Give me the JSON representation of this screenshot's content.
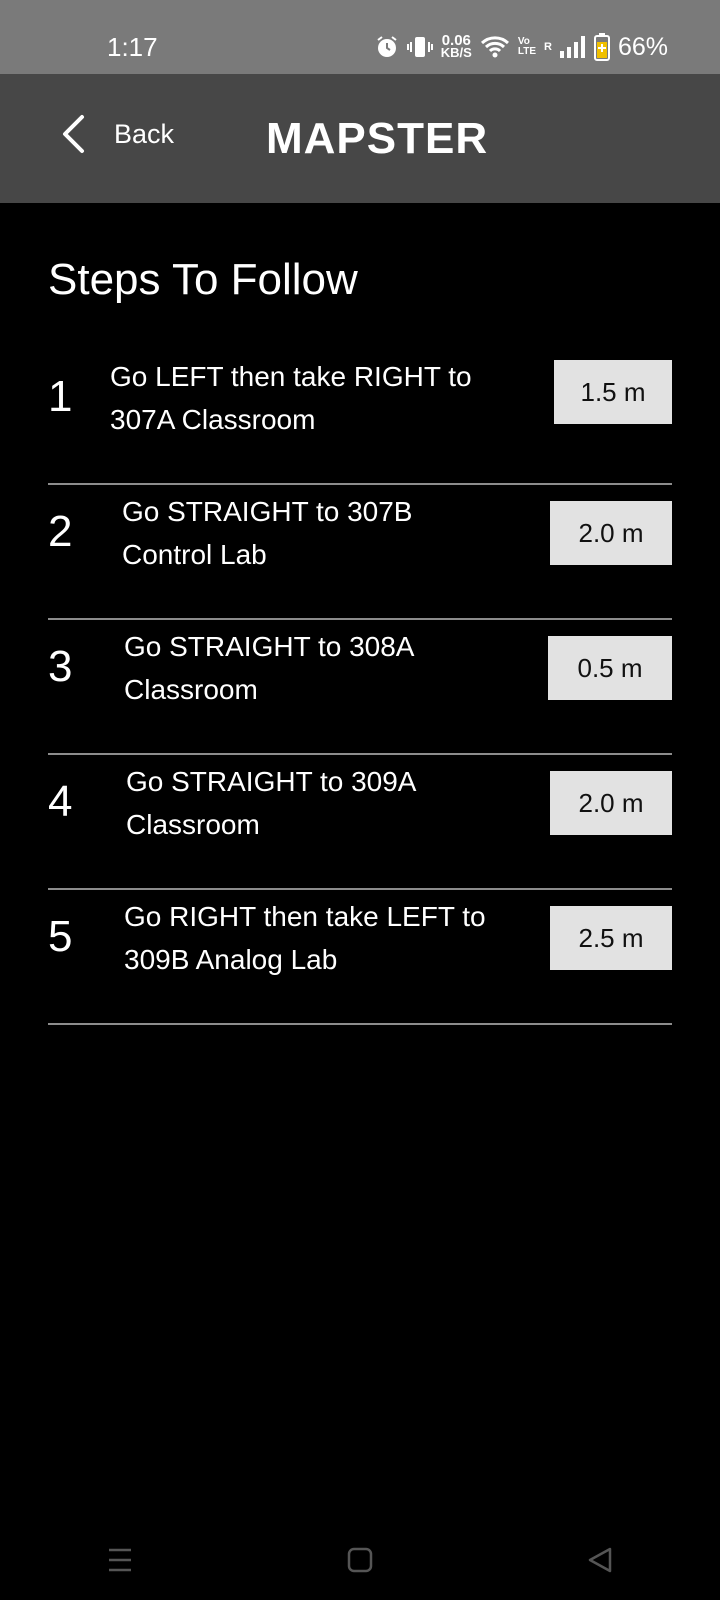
{
  "status_bar": {
    "time": "1:17",
    "net_speed_value": "0.06",
    "net_speed_unit": "KB/S",
    "volte_top": "Vo",
    "volte_bottom": "LTE",
    "roaming": "R",
    "battery_percent": "66%"
  },
  "header": {
    "back_label": "Back",
    "title": "MAPSTER"
  },
  "section_title": "Steps To Follow",
  "steps": [
    {
      "number": "1",
      "text": "Go LEFT then take RIGHT to 307A Classroom",
      "distance": "1.5 m"
    },
    {
      "number": "2",
      "text": "Go STRAIGHT to 307B Control Lab",
      "distance": "2.0 m"
    },
    {
      "number": "3",
      "text": "Go STRAIGHT to 308A Classroom",
      "distance": "0.5 m"
    },
    {
      "number": "4",
      "text": "Go STRAIGHT to 309A Classroom",
      "distance": "2.0 m"
    },
    {
      "number": "5",
      "text": "Go RIGHT then take LEFT to 309B Analog Lab",
      "distance": "2.5 m"
    }
  ],
  "nav_bar": {
    "icons": [
      "recents-icon",
      "home-icon",
      "back-triangle-icon"
    ]
  },
  "colors": {
    "status_bar": "#7a7a7a",
    "header": "#474747",
    "background": "#000000",
    "distance_badge": "#e2e2e2",
    "divider": "#8c8c8c"
  }
}
